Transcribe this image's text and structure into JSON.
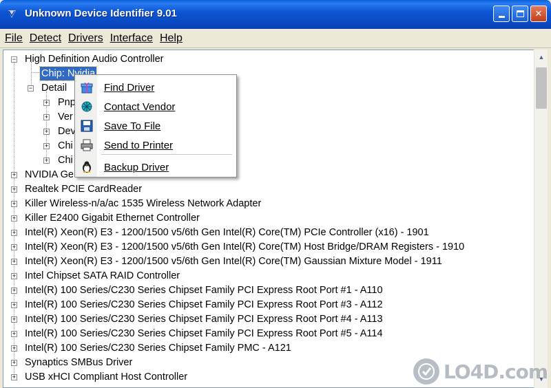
{
  "window": {
    "title": "Unknown Device Identifier 9.01"
  },
  "menu": [
    "File",
    "Detect",
    "Drivers",
    "Interface",
    "Help"
  ],
  "tree": {
    "root_label": "High Definition Audio Controller",
    "child_selected": "Chip: Nvidia",
    "detail_label": "Detail",
    "detail_children": [
      "Pnp",
      "Ver",
      "Dev",
      "Chi",
      "Chi"
    ],
    "devices": [
      "NVIDIA Ge",
      "Realtek PCIE CardReader",
      "Killer Wireless-n/a/ac 1535 Wireless Network Adapter",
      "Killer E2400 Gigabit Ethernet Controller",
      "Intel(R) Xeon(R) E3 - 1200/1500 v5/6th Gen Intel(R) Core(TM) PCIe Controller (x16) - 1901",
      "Intel(R) Xeon(R) E3 - 1200/1500 v5/6th Gen Intel(R) Core(TM) Host Bridge/DRAM Registers - 1910",
      "Intel(R) Xeon(R) E3 - 1200/1500 v5/6th Gen Intel(R) Core(TM) Gaussian Mixture Model - 1911",
      "Intel Chipset SATA RAID Controller",
      "Intel(R) 100 Series/C230 Series Chipset Family PCI Express Root Port #1 - A110",
      "Intel(R) 100 Series/C230 Series Chipset Family PCI Express Root Port #3 - A112",
      "Intel(R) 100 Series/C230 Series Chipset Family PCI Express Root Port #4 - A113",
      "Intel(R) 100 Series/C230 Series Chipset Family PCI Express Root Port #5 - A114",
      "Intel(R) 100 Series/C230 Series Chipset Family PMC - A121",
      "Synaptics SMBus Driver",
      "USB xHCI Compliant Host Controller"
    ]
  },
  "context_menu": {
    "items": [
      {
        "label": "Find Driver",
        "icon": "gift-icon"
      },
      {
        "label": "Contact Vendor",
        "icon": "network-icon"
      },
      {
        "label": "Save To File",
        "icon": "floppy-disk-icon"
      },
      {
        "label": "Send to Printer",
        "icon": "printer-icon"
      },
      {
        "label": "Backup Driver",
        "icon": "penguin-icon"
      }
    ]
  },
  "watermark": {
    "text": "LO4D.com"
  }
}
